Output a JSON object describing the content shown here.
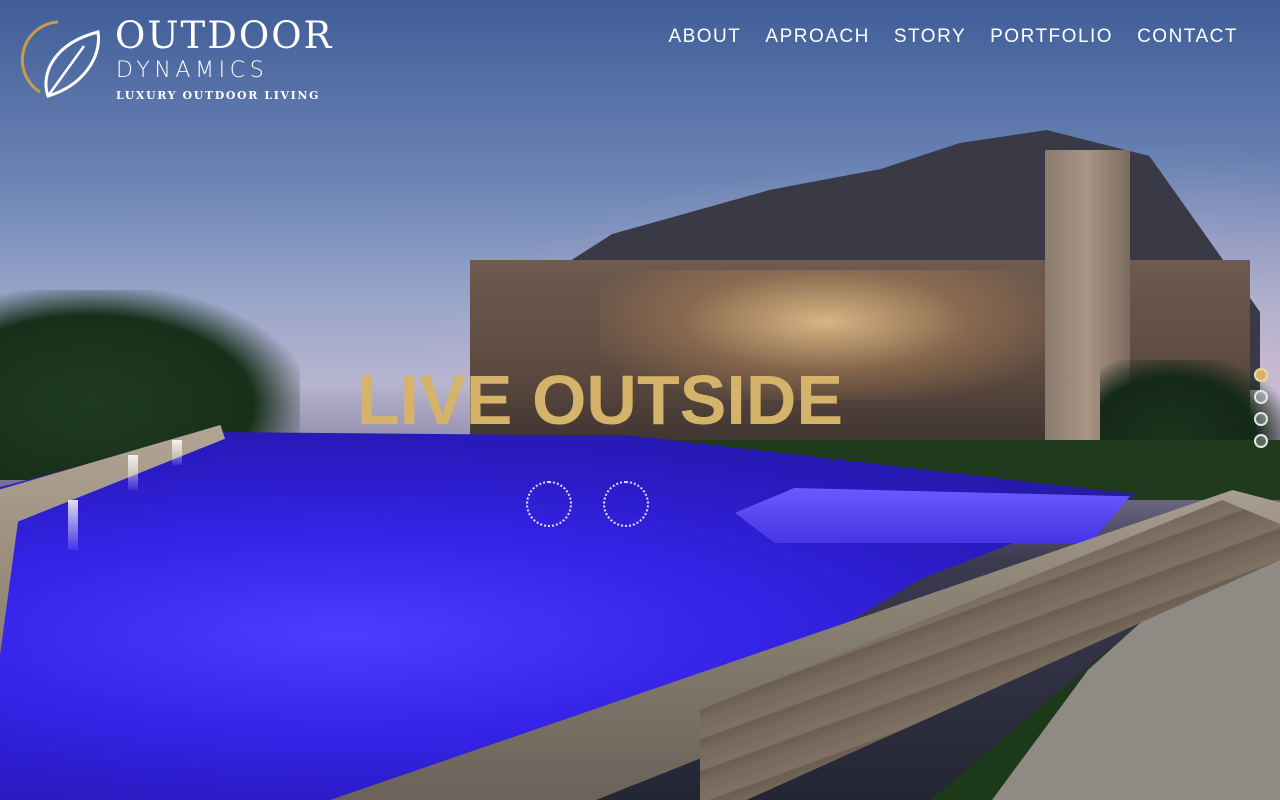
{
  "brand": {
    "title": "OUTDOOR",
    "subtitle": "DYNAMICS",
    "tagline": "LUXURY OUTDOOR LIVING",
    "icon": "leaf-logo-icon"
  },
  "nav": {
    "items": [
      {
        "label": "ABOUT"
      },
      {
        "label": "APROACH"
      },
      {
        "label": "STORY"
      },
      {
        "label": "PORTFOLIO"
      },
      {
        "label": "CONTACT"
      }
    ]
  },
  "hero": {
    "headline": "LIVE OUTSIDE"
  },
  "slider": {
    "count": 4,
    "active_index": 0
  },
  "colors": {
    "accent": "#d6b36a",
    "text": "#ffffff",
    "logo_arc": "#c89b48"
  }
}
